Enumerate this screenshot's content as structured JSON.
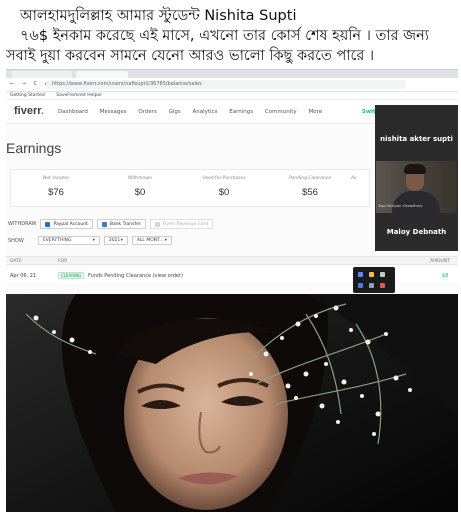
{
  "caption": {
    "line1": "আলহামদুলিল্লাহ আমার স্টুডেন্ট Nishita Supti",
    "line2": "৭৬$ ইনকাম করেছে এই মাসে, এখনো  তার কোর্স শেষ হয়নি । তার জন্য",
    "line3": "সবাই দুয়া করবেন সামনে যেনো আরও ভালো কিছু করতে পারে ।"
  },
  "browser": {
    "nav_glyphs": "← → C ⌂",
    "url": "https://www.fiverr.com/users/nafisuptii/36765/balance/sales",
    "bookmarks": [
      "Getting Started",
      "SaveFromnet Helper"
    ]
  },
  "fiverr": {
    "logo": "fiverr",
    "logo_dot": ".",
    "menu": [
      "Dashboard",
      "Messages",
      "Orders",
      "Gigs",
      "Analytics",
      "Earnings",
      "Community",
      "More"
    ],
    "switch_label": "Switch"
  },
  "earnings": {
    "title": "Earnings",
    "stats": [
      {
        "label": "Net Income",
        "value": "$76"
      },
      {
        "label": "Withdrawn",
        "value": "$0"
      },
      {
        "label": "Used for Purchases",
        "value": "$0"
      },
      {
        "label": "Pending Clearance",
        "value": "$56"
      },
      {
        "label": "Av",
        "value": ""
      }
    ],
    "withdraw_label": "WITHDRAW",
    "withdraw_options": [
      "Paypal Account",
      "Bank Transfer",
      "Fiverr Revenue Card"
    ],
    "show_label": "SHOW",
    "filters": [
      "EVERYTHING",
      "2021",
      "ALL MONT..."
    ],
    "table_headers": {
      "date": "DATE",
      "for": "FOR",
      "amount": "AMOUNT"
    },
    "rows": [
      {
        "date": "Apr 06, 21",
        "badge": "CLEARING",
        "description": "Funds Pending Clearance (view order)",
        "amount": "$8"
      }
    ]
  },
  "video_call": {
    "participant1": "nishita akter supti",
    "participant2": "Maloy Debnath",
    "tile_tag": "Tapu Bhuiyan Chowdhury"
  },
  "colors": {
    "fiverr_green": "#1dbf73",
    "call_panel": "#2b2b2b"
  }
}
